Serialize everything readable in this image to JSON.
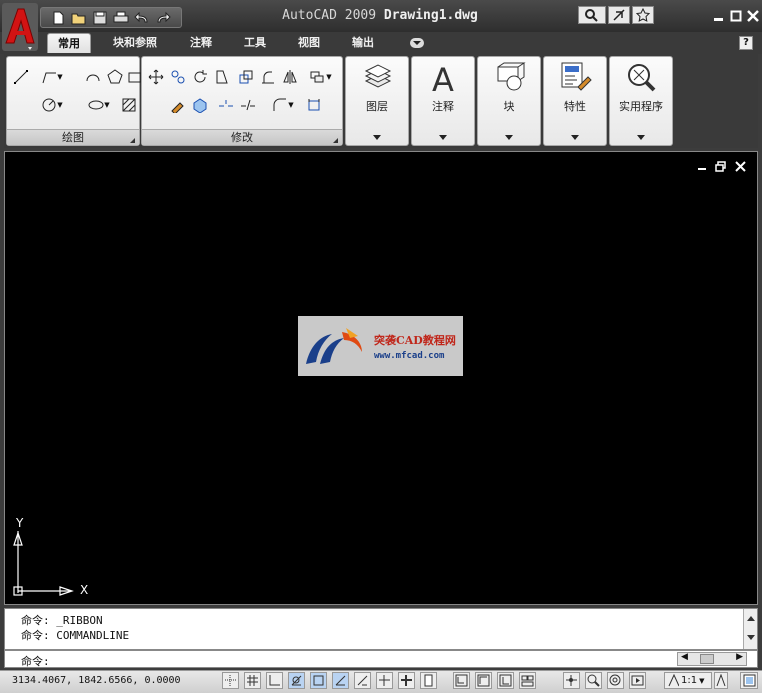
{
  "title_bar": {
    "app_name": "AutoCAD 2009",
    "document_name": "Drawing1.dwg"
  },
  "quick_access": [
    "new-icon",
    "open-icon",
    "save-icon",
    "print-icon",
    "undo-icon",
    "redo-icon"
  ],
  "info_center": [
    "search-icon",
    "communication-icon",
    "favorites-icon"
  ],
  "tabs": [
    {
      "label": "常用",
      "active": true
    },
    {
      "label": "块和参照",
      "active": false
    },
    {
      "label": "注释",
      "active": false
    },
    {
      "label": "工具",
      "active": false
    },
    {
      "label": "视图",
      "active": false
    },
    {
      "label": "输出",
      "active": false
    }
  ],
  "help_label": "?",
  "ribbon": {
    "draw_panel_title": "绘图",
    "modify_panel_title": "修改",
    "big_panels": [
      {
        "label": "图层",
        "icon": "layers-icon"
      },
      {
        "label": "注释",
        "icon": "annotation-icon"
      },
      {
        "label": "块",
        "icon": "block-icon"
      },
      {
        "label": "特性",
        "icon": "properties-icon"
      },
      {
        "label": "实用程序",
        "icon": "utilities-icon"
      }
    ]
  },
  "canvas": {
    "watermark_cn": "突袭CAD教程网",
    "watermark_url": "www.mfcad.com",
    "ucs_x": "X",
    "ucs_y": "Y"
  },
  "command": {
    "history": [
      "命令: _RIBBON",
      "命令: COMMANDLINE"
    ],
    "prompt": "命令:"
  },
  "status": {
    "coordinates": "3134.4067, 1842.6566, 0.0000",
    "scale": "1:1"
  },
  "colors": {
    "canvas_bg": "#000000",
    "chrome_dark": "#3a3a3a",
    "logo_red": "#cc1111"
  }
}
